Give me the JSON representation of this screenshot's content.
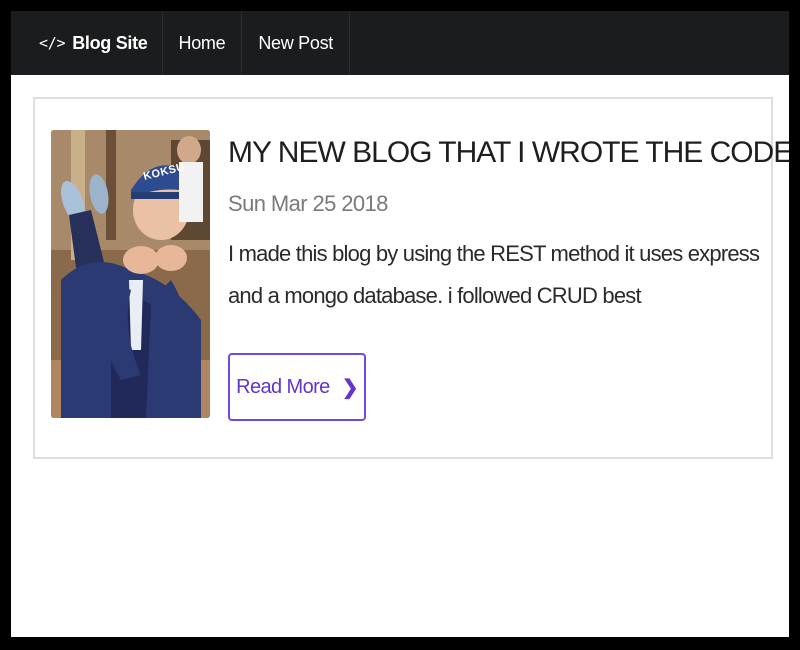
{
  "navbar": {
    "brand_icon": "</>",
    "brand_label": "Blog Site",
    "items": [
      {
        "label": "Home"
      },
      {
        "label": "New Post"
      }
    ]
  },
  "post": {
    "title": "MY NEW BLOG THAT I WROTE THE CODE FOR!",
    "date": "Sun Mar 25 2018",
    "description": "I made this blog by using the REST method it uses express and a mongo database. i followed CRUD best",
    "image_text": "KOKSU",
    "read_more_label": "Read More",
    "read_more_icon": "chevron-right-icon"
  },
  "colors": {
    "navbar_bg": "#1b1c1d",
    "accent": "#6435c9",
    "card_border": "#dedede"
  }
}
